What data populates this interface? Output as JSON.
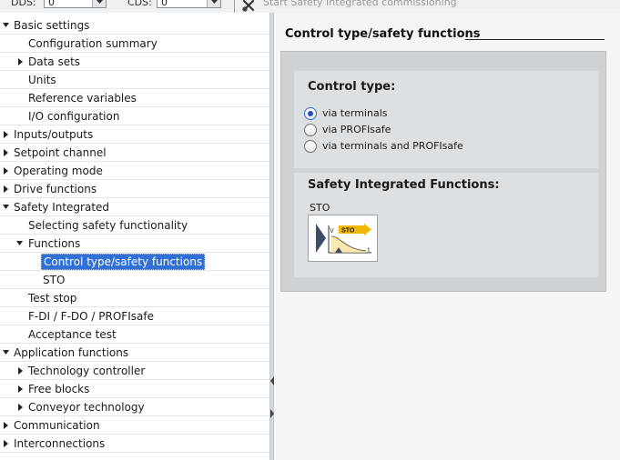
{
  "toolbar": {
    "dds_label": "DDS:",
    "dds_value": "0",
    "cds_label": "CDS:",
    "cds_value": "0",
    "commissioning_label": "Start Safety Integrated commissioning"
  },
  "tree": {
    "items": [
      {
        "label": "Basic settings",
        "expanded": true,
        "selected": false
      },
      {
        "label": "Configuration summary",
        "selected": false
      },
      {
        "label": "Data sets",
        "expanded": false,
        "selected": false
      },
      {
        "label": "Units",
        "selected": false
      },
      {
        "label": "Reference variables",
        "selected": false
      },
      {
        "label": "I/O configuration",
        "selected": false
      },
      {
        "label": "Inputs/outputs",
        "expanded": false,
        "selected": false
      },
      {
        "label": "Setpoint channel",
        "expanded": false,
        "selected": false
      },
      {
        "label": "Operating mode",
        "expanded": false,
        "selected": false
      },
      {
        "label": "Drive functions",
        "expanded": false,
        "selected": false
      },
      {
        "label": "Safety Integrated",
        "expanded": true,
        "selected": false
      },
      {
        "label": "Selecting safety functionality",
        "selected": false
      },
      {
        "label": "Functions",
        "expanded": true,
        "selected": false
      },
      {
        "label": "Control type/safety functions",
        "selected": true
      },
      {
        "label": "STO",
        "selected": false
      },
      {
        "label": "Test stop",
        "selected": false
      },
      {
        "label": "F-DI / F-DO / PROFIsafe",
        "selected": false
      },
      {
        "label": "Acceptance test",
        "selected": false
      },
      {
        "label": "Application functions",
        "expanded": true,
        "selected": false
      },
      {
        "label": "Technology controller",
        "expanded": false,
        "selected": false
      },
      {
        "label": "Free blocks",
        "expanded": false,
        "selected": false
      },
      {
        "label": "Conveyor technology",
        "expanded": false,
        "selected": false
      },
      {
        "label": "Communication",
        "expanded": false,
        "selected": false
      },
      {
        "label": "Interconnections",
        "expanded": false,
        "selected": false
      }
    ]
  },
  "panel": {
    "title": "Control type/safety functions",
    "control_type": {
      "title": "Control type:",
      "options": [
        {
          "label": "via terminals",
          "checked": true
        },
        {
          "label": "via PROFIsafe",
          "checked": false
        },
        {
          "label": "via terminals and PROFIsafe",
          "checked": false
        }
      ]
    },
    "safety_functions": {
      "title": "Safety Integrated Functions:",
      "sto_label": "STO",
      "sto_icon_text": "STO",
      "sto_axis_v": "V",
      "sto_axis_t": "t"
    }
  },
  "colors": {
    "selection": "#2f6fd6",
    "sto_highlight": "#f2b705"
  },
  "icons": {
    "commissioning": "pliers-icon",
    "sto": "sto-function-icon"
  }
}
